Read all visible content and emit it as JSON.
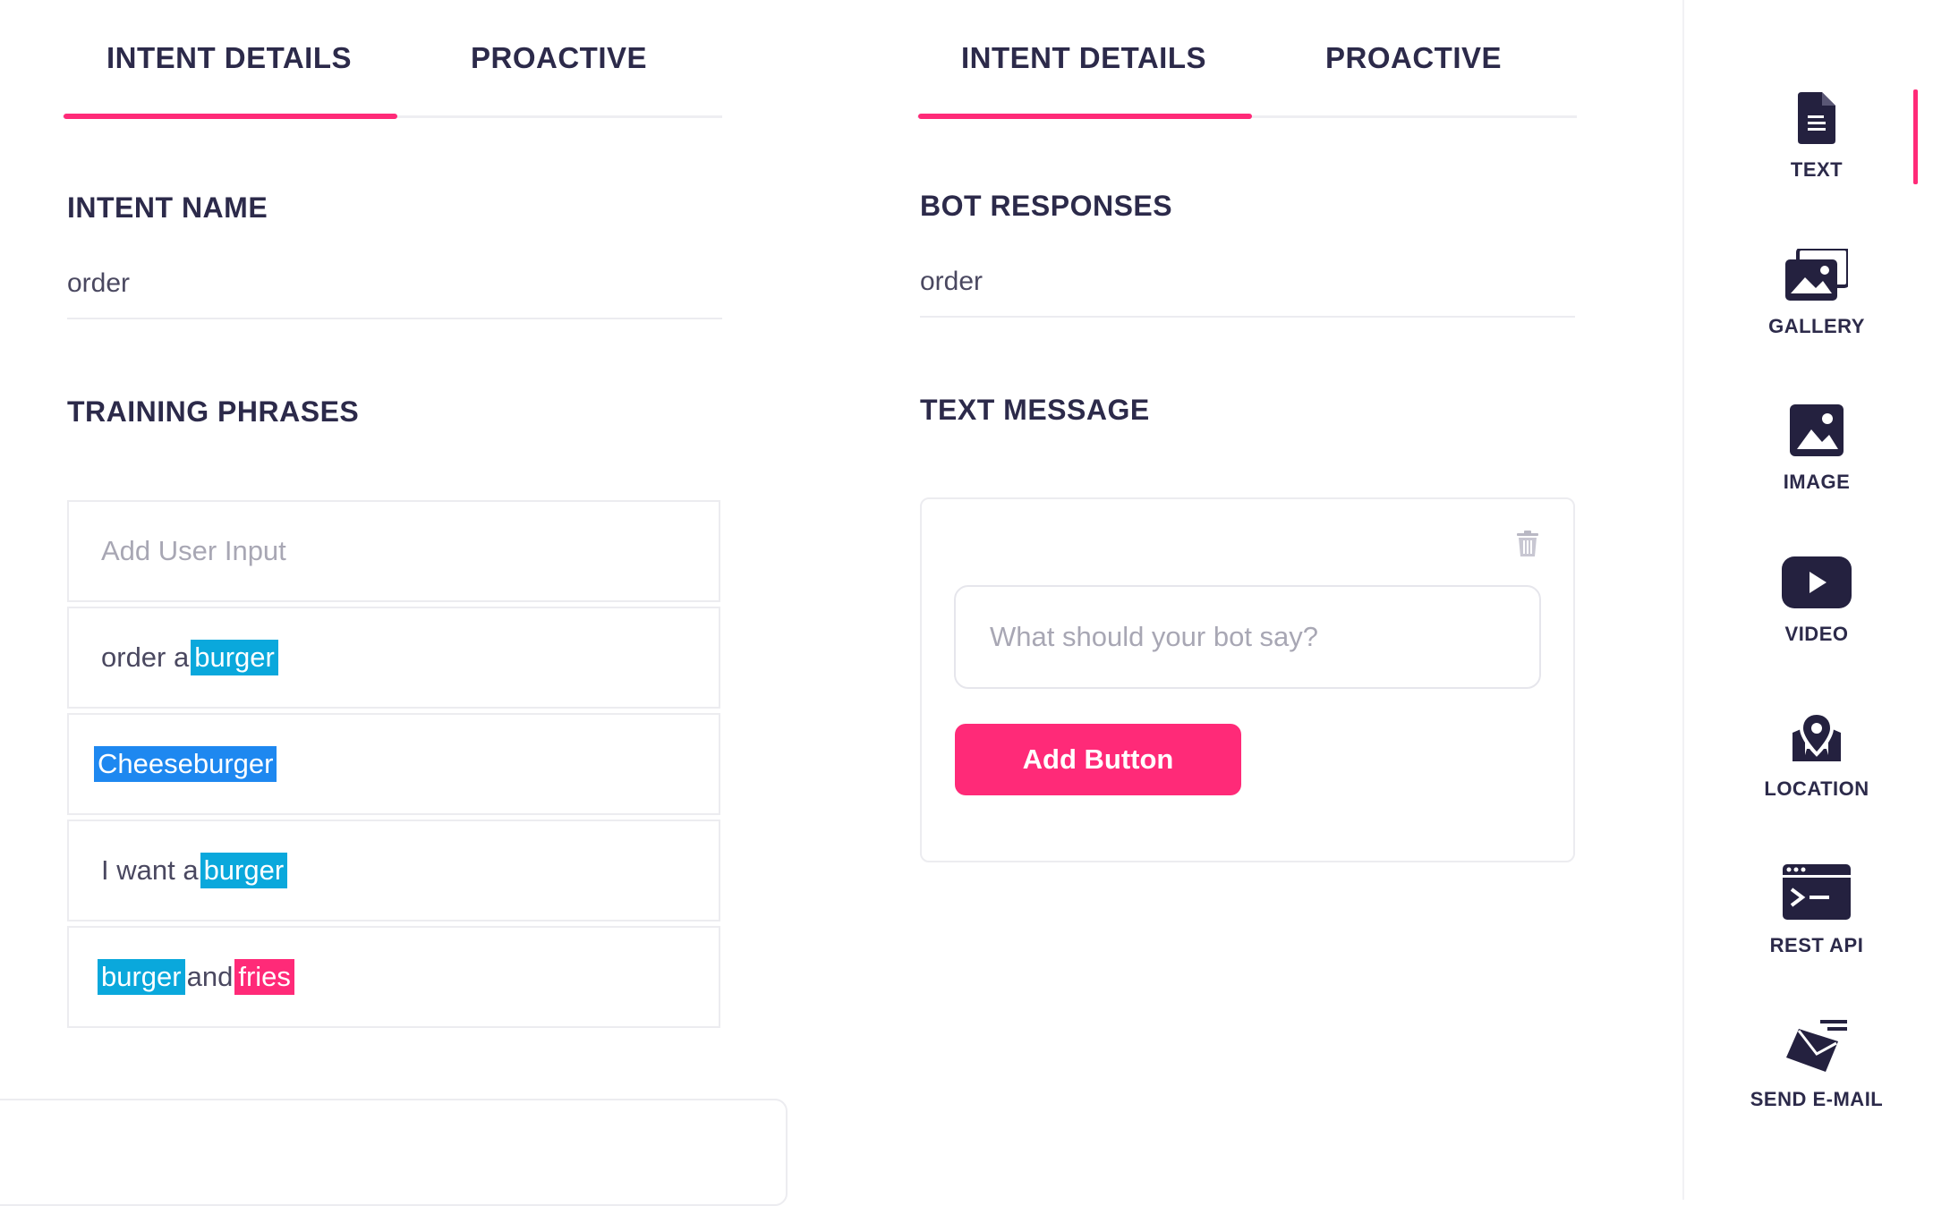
{
  "left_panel": {
    "tabs": [
      {
        "label": "INTENT DETAILS",
        "active": true
      },
      {
        "label": "PROACTIVE",
        "active": false
      }
    ],
    "intent_name_title": "INTENT NAME",
    "intent_name_value": "order",
    "training_title": "TRAINING PHRASES",
    "add_input_placeholder": "Add User Input",
    "phrases": [
      {
        "parts": [
          {
            "text": "order a",
            "highlight": null
          },
          {
            "text": "burger",
            "highlight": "cyan"
          }
        ]
      },
      {
        "parts": [
          {
            "text": "Cheeseburger",
            "highlight": "blue"
          }
        ]
      },
      {
        "parts": [
          {
            "text": "I want a",
            "highlight": null
          },
          {
            "text": "burger",
            "highlight": "cyan"
          }
        ]
      },
      {
        "parts": [
          {
            "text": "burger",
            "highlight": "cyan"
          },
          {
            "text": "and",
            "highlight": null
          },
          {
            "text": "fries",
            "highlight": "pink"
          }
        ]
      }
    ]
  },
  "right_panel": {
    "tabs": [
      {
        "label": "INTENT DETAILS",
        "active": true
      },
      {
        "label": "PROACTIVE",
        "active": false
      }
    ],
    "bot_responses_title": "BOT RESPONSES",
    "bot_responses_value": "order",
    "text_message_title": "TEXT MESSAGE",
    "message_placeholder": "What should your bot say?",
    "add_button_label": "Add Button"
  },
  "sidebar": {
    "items": [
      {
        "label": "TEXT",
        "icon": "text-document-icon",
        "active": true
      },
      {
        "label": "GALLERY",
        "icon": "gallery-icon",
        "active": false
      },
      {
        "label": "IMAGE",
        "icon": "image-icon",
        "active": false
      },
      {
        "label": "VIDEO",
        "icon": "video-play-icon",
        "active": false
      },
      {
        "label": "LOCATION",
        "icon": "location-pin-icon",
        "active": false
      },
      {
        "label": "REST API",
        "icon": "terminal-icon",
        "active": false
      },
      {
        "label": "SEND E-MAIL",
        "icon": "email-icon",
        "active": false
      }
    ]
  },
  "colors": {
    "accent": "#ff2a78",
    "highlight_cyan": "#0aa8dc",
    "highlight_blue": "#1e88f0",
    "highlight_pink": "#ff2a78",
    "text_dark": "#2c2a4a"
  }
}
